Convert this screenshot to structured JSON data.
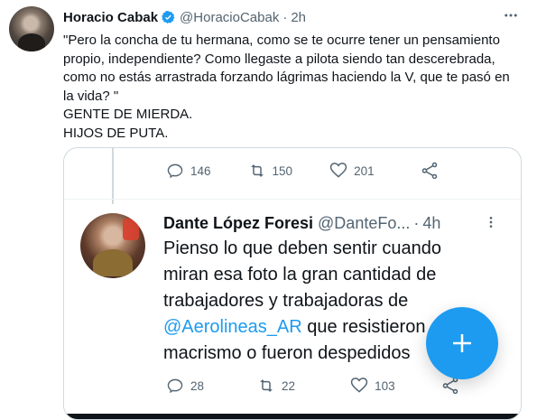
{
  "tweet": {
    "author_name": "Horacio Cabak",
    "author_handle": "@HoracioCabak",
    "dot": "·",
    "time": "2h",
    "text_lines": [
      "\"Pero la concha de tu hermana, como se te ocurre tener un pensamiento",
      "propio, independiente? Como llegaste a pilota siendo tan descerebrada,",
      "como no estás arrastrada forzando lágrimas haciendo la V, que te pasó en",
      "la vida? \"",
      "GENTE DE MIERDA.",
      "HIJOS DE PUTA."
    ],
    "actions": {
      "replies": "146",
      "retweets": "150",
      "likes": "201"
    }
  },
  "quoted": {
    "author_name": "Dante López Foresi",
    "author_handle": "@DanteFo...",
    "dot": "·",
    "time": "4h",
    "text_lines": [
      "Pienso lo que deben sentir cuando",
      "miran esa foto la gran cantidad de",
      "trabajadores y trabajadoras de"
    ],
    "mention": "@Aerolineas_AR",
    "mention_suffix": " que resistieron",
    "last_line": "macrismo o fueron despedidos",
    "actions": {
      "replies": "28",
      "retweets": "22",
      "likes": "103"
    }
  },
  "icons": {
    "verified": "verified-badge-icon",
    "more": "more-dots-icon",
    "reply": "reply-icon",
    "retweet": "retweet-icon",
    "like": "heart-icon",
    "share": "share-icon",
    "compose": "plus-icon"
  },
  "colors": {
    "accent": "#1d9bf0",
    "text": "#0f1419",
    "muted": "#536471",
    "border": "#cfd9de"
  }
}
